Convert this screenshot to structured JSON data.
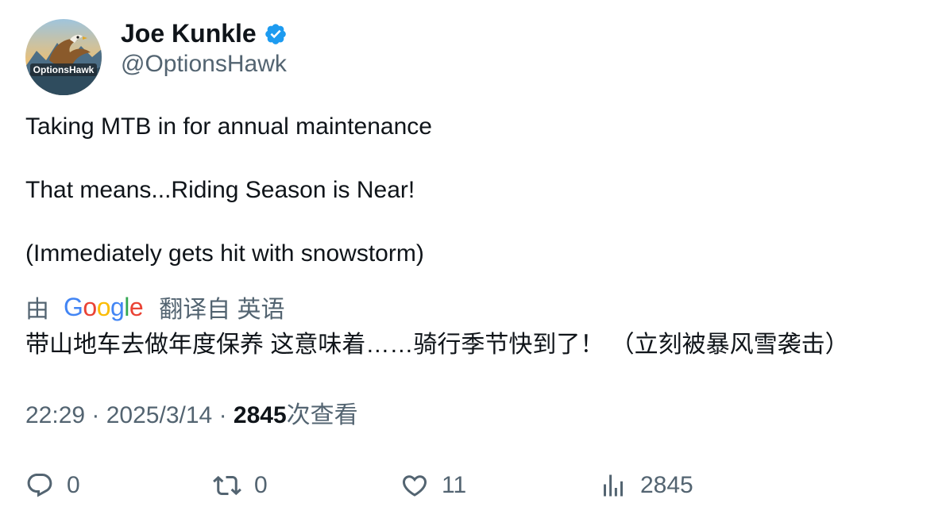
{
  "author": {
    "name": "Joe Kunkle",
    "handle": "@OptionsHawk",
    "avatar_text": "OptionsHawk",
    "verified_icon": "verified-badge-icon",
    "accent": "#1d9bf0"
  },
  "tweet": {
    "lines": [
      "Taking MTB in for annual maintenance",
      "That means...Riding Season is Near!",
      "(Immediately gets hit with snowstorm)"
    ]
  },
  "translation": {
    "by_label": "由",
    "provider": "Google",
    "from_label": "翻译自 英语",
    "text": "带山地车去做年度保养 这意味着……骑行季节快到了！ （立刻被暴风雪袭击）"
  },
  "meta": {
    "time": "22:29",
    "separator": "·",
    "date": "2025/3/14",
    "views_count": "2845",
    "views_label": "次查看"
  },
  "actions": {
    "reply": {
      "icon": "reply-icon",
      "count": "0"
    },
    "retweet": {
      "icon": "retweet-icon",
      "count": "0"
    },
    "like": {
      "icon": "heart-icon",
      "count": "11"
    },
    "views": {
      "icon": "views-chart-icon",
      "count": "2845"
    }
  },
  "colors": {
    "text_primary": "#0f1419",
    "text_secondary": "#536471",
    "verified_blue": "#1d9bf0"
  }
}
